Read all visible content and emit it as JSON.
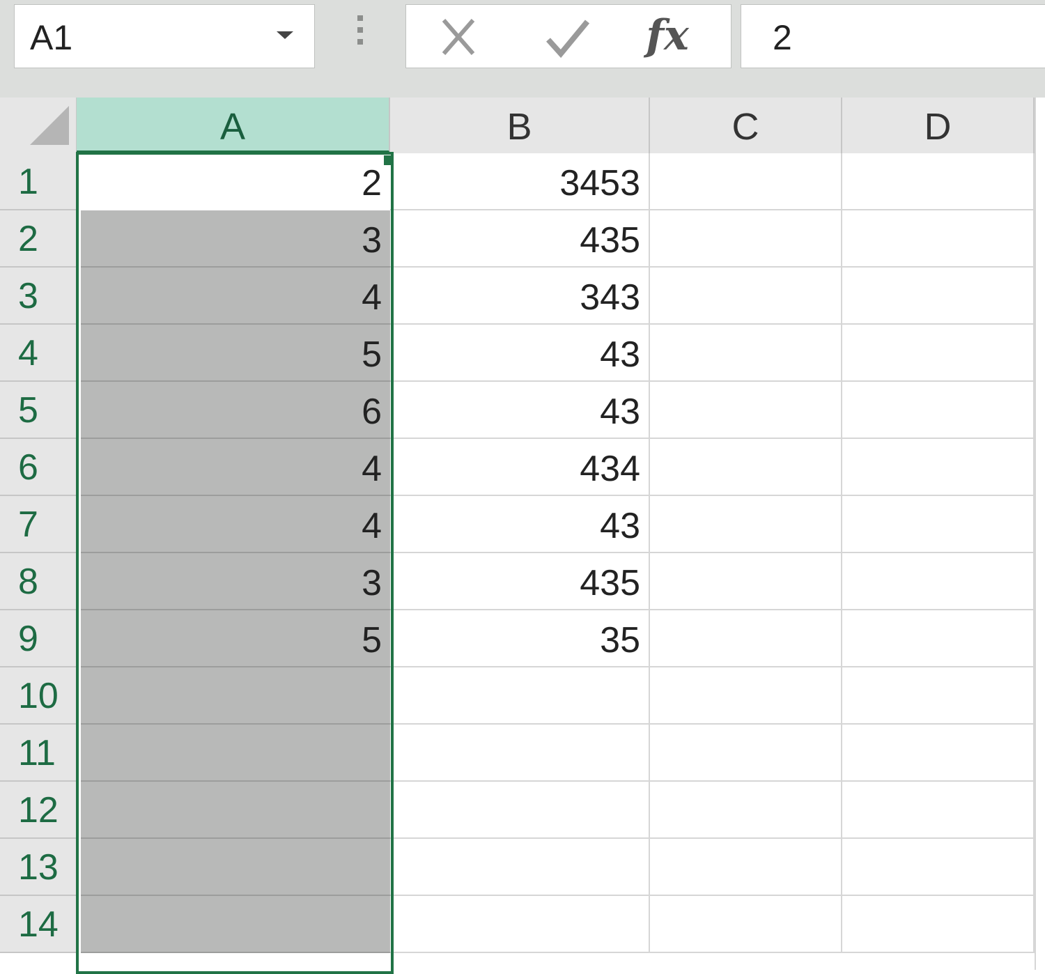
{
  "formula_bar": {
    "name_box": "A1",
    "formula_value": "2",
    "fx_label": "fx"
  },
  "columns": [
    "A",
    "B",
    "C",
    "D"
  ],
  "selected_column": "A",
  "active_cell": "A1",
  "rows": [
    {
      "num": "1",
      "a": "2",
      "b": "3453"
    },
    {
      "num": "2",
      "a": "3",
      "b": "435"
    },
    {
      "num": "3",
      "a": "4",
      "b": "343"
    },
    {
      "num": "4",
      "a": "5",
      "b": "43"
    },
    {
      "num": "5",
      "a": "6",
      "b": "43"
    },
    {
      "num": "6",
      "a": "4",
      "b": "434"
    },
    {
      "num": "7",
      "a": "4",
      "b": "43"
    },
    {
      "num": "8",
      "a": "3",
      "b": "435"
    },
    {
      "num": "9",
      "a": "5",
      "b": "35"
    },
    {
      "num": "10",
      "a": "",
      "b": ""
    },
    {
      "num": "11",
      "a": "",
      "b": ""
    },
    {
      "num": "12",
      "a": "",
      "b": ""
    },
    {
      "num": "13",
      "a": "",
      "b": ""
    },
    {
      "num": "14",
      "a": "",
      "b": ""
    }
  ],
  "colors": {
    "accent": "#217346",
    "selected_header": "#b3dfd0",
    "selection_fill": "#b8b9b8"
  }
}
